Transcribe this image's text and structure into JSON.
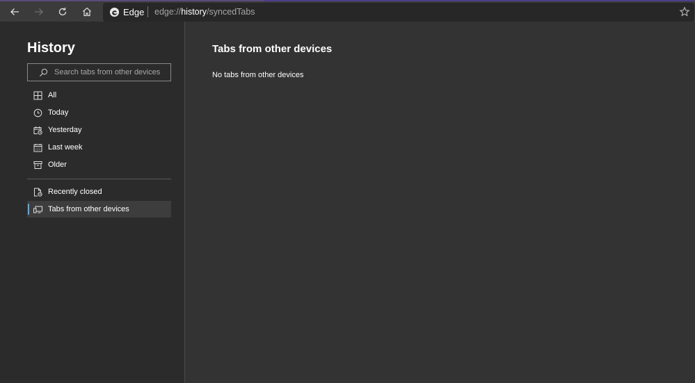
{
  "browser": {
    "site_name": "Edge",
    "url_prefix": "edge://",
    "url_host": "history",
    "url_path": "/syncedTabs"
  },
  "sidebar": {
    "title": "History",
    "search_placeholder": "Search tabs from other devices",
    "items": [
      {
        "label": "All",
        "icon": "grid-icon"
      },
      {
        "label": "Today",
        "icon": "clock-icon"
      },
      {
        "label": "Yesterday",
        "icon": "calendar-clock-icon"
      },
      {
        "label": "Last week",
        "icon": "calendar-icon"
      },
      {
        "label": "Older",
        "icon": "archive-icon"
      }
    ],
    "secondary_items": [
      {
        "label": "Recently closed",
        "icon": "recently-closed-icon"
      },
      {
        "label": "Tabs from other devices",
        "icon": "devices-icon",
        "active": true
      }
    ]
  },
  "main": {
    "title": "Tabs from other devices",
    "empty_message": "No tabs from other devices"
  },
  "colors": {
    "accent": "#5aa8e6",
    "background": "#333333",
    "sidebar": "#2b2b2b"
  }
}
